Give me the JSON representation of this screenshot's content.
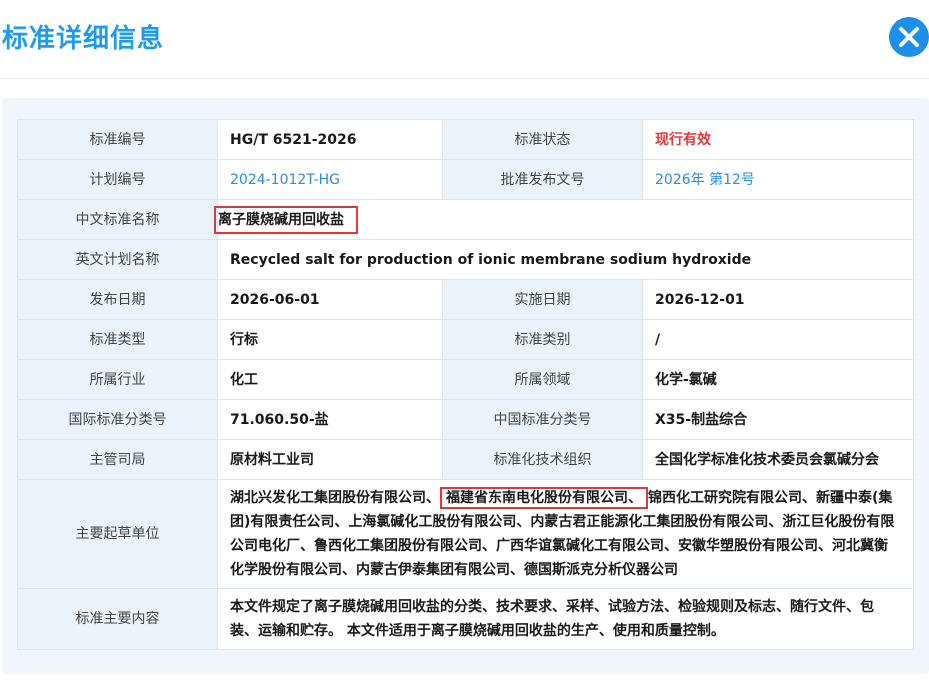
{
  "header": {
    "title": "标准详细信息"
  },
  "table": {
    "rows": [
      {
        "l1": "标准编号",
        "v1": "HG/T 6521-2026",
        "l2": "标准状态",
        "v2": "现行有效"
      },
      {
        "l1": "计划编号",
        "v1": "2024-1012T-HG",
        "l2": "批准发布文号",
        "v2": "2026年 第12号"
      },
      {
        "l1": "中文标准名称",
        "v1": "离子膜烧碱用回收盐"
      },
      {
        "l1": "英文计划名称",
        "v1": "Recycled salt for production of ionic membrane sodium hydroxide"
      },
      {
        "l1": "发布日期",
        "v1": "2026-06-01",
        "l2": "实施日期",
        "v2": "2026-12-01"
      },
      {
        "l1": "标准类型",
        "v1": "行标",
        "l2": "标准类别",
        "v2": "/"
      },
      {
        "l1": "所属行业",
        "v1": "化工",
        "l2": "所属领域",
        "v2": "化学-氯碱"
      },
      {
        "l1": "国际标准分类号",
        "v1": "71.060.50-盐",
        "l2": "中国标准分类号",
        "v2": "X35-制盐综合"
      },
      {
        "l1": "主管司局",
        "v1": "原材料工业司",
        "l2": "标准化技术组织",
        "v2": "全国化学标准化技术委员会氯碱分会"
      }
    ],
    "drafters": {
      "label": "主要起草单位",
      "part1": "湖北兴发化工集团股份有限公司、",
      "highlight": "福建省东南电化股份有限公司、",
      "part2": "锦西化工研究院有限公司、新疆中泰(集团)有限责任公司、上海氯碱化工股份有限公司、内蒙古君正能源化工集团股份有限公司、浙江巨化股份有限公司电化厂、鲁西化工集团股份有限公司、广西华谊氯碱化工有限公司、安徽华塑股份有限公司、河北冀衡化学股份有限公司、内蒙古伊泰集团有限公司、德国斯派克分析仪器公司"
    },
    "content": {
      "label": "标准主要内容",
      "text": "本文件规定了离子膜烧碱用回收盐的分类、技术要求、采样、试验方法、检验规则及标志、随行文件、包装、运输和贮存。 本文件适用于离子膜烧碱用回收盐的生产、使用和质量控制。"
    }
  }
}
